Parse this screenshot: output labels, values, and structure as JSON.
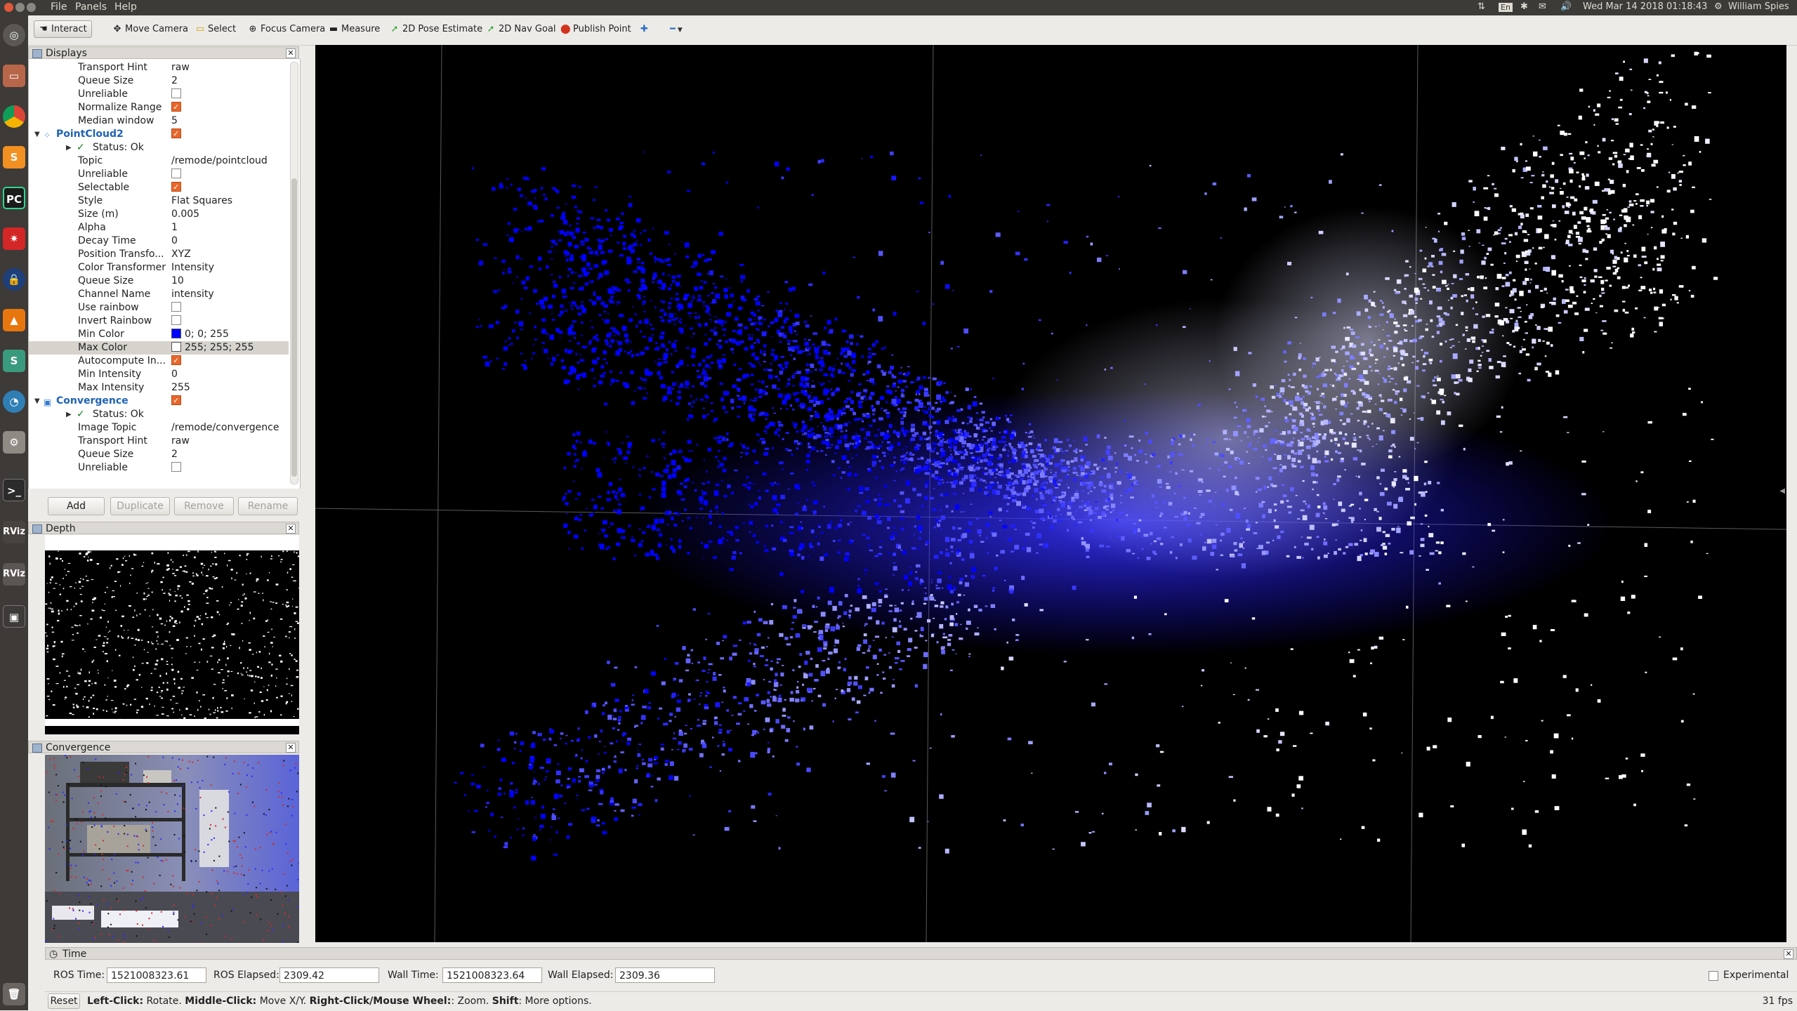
{
  "menubar": {
    "menus": [
      "File",
      "Panels",
      "Help"
    ],
    "indicators": [
      "En"
    ],
    "datetime": "Wed Mar 14 2018 01:18:43",
    "user": "William Spies"
  },
  "launcher": {
    "icons": [
      "dash-icon",
      "files-icon",
      "chrome-icon",
      "sublime-icon",
      "pycharm-icon",
      "wolfram-icon",
      "keepass-icon",
      "vlc-icon",
      "slack-icon",
      "clock-icon",
      "settings-icon",
      "terminal-icon",
      "rviz-icon",
      "rviz-icon",
      "workspace-icon",
      "trash-icon"
    ],
    "labels": {
      "slack": "S",
      "pycharm": "PC",
      "rviz": "RViz"
    }
  },
  "toolbar": {
    "interact": "Interact",
    "move_camera": "Move Camera",
    "select": "Select",
    "focus_camera": "Focus Camera",
    "measure": "Measure",
    "pose_estimate": "2D Pose Estimate",
    "nav_goal": "2D Nav Goal",
    "publish_point": "Publish Point"
  },
  "displays": {
    "title": "Displays",
    "rows": [
      {
        "key": "Transport Hint",
        "value": "raw"
      },
      {
        "key": "Queue Size",
        "value": "2"
      },
      {
        "key": "Unreliable",
        "check": false
      },
      {
        "key": "Normalize Range",
        "check": true
      },
      {
        "key": "Median window",
        "value": "5"
      },
      {
        "key": "PointCloud2",
        "plugin": true,
        "check": true
      },
      {
        "key": "Status: Ok",
        "status": true
      },
      {
        "key": "Topic",
        "value": "/remode/pointcloud"
      },
      {
        "key": "Unreliable",
        "check": false
      },
      {
        "key": "Selectable",
        "check": true
      },
      {
        "key": "Style",
        "value": "Flat Squares"
      },
      {
        "key": "Size (m)",
        "value": "0.005"
      },
      {
        "key": "Alpha",
        "value": "1"
      },
      {
        "key": "Decay Time",
        "value": "0"
      },
      {
        "key": "Position Transfo...",
        "value": "XYZ"
      },
      {
        "key": "Color Transformer",
        "value": "Intensity"
      },
      {
        "key": "Queue Size",
        "value": "10"
      },
      {
        "key": "Channel Name",
        "value": "intensity"
      },
      {
        "key": "Use rainbow",
        "check": false
      },
      {
        "key": "Invert Rainbow",
        "check": false
      },
      {
        "key": "Min Color",
        "value": "0; 0; 255",
        "swatch": "#0000ff"
      },
      {
        "key": "Max Color",
        "value": "255; 255; 255",
        "swatch": "#ffffff",
        "selected": true
      },
      {
        "key": "Autocompute In...",
        "check": true
      },
      {
        "key": "Min Intensity",
        "value": "0"
      },
      {
        "key": "Max Intensity",
        "value": "255"
      },
      {
        "key": "Convergence",
        "plugin": true,
        "check": true
      },
      {
        "key": "Status: Ok",
        "status": true
      },
      {
        "key": "Image Topic",
        "value": "/remode/convergence"
      },
      {
        "key": "Transport Hint",
        "value": "raw"
      },
      {
        "key": "Queue Size",
        "value": "2"
      },
      {
        "key": "Unreliable",
        "check": false
      }
    ],
    "buttons": {
      "add": "Add",
      "duplicate": "Duplicate",
      "remove": "Remove",
      "rename": "Rename"
    }
  },
  "depth": {
    "title": "Depth"
  },
  "convergence": {
    "title": "Convergence"
  },
  "time": {
    "title": "Time",
    "ros_time_label": "ROS Time:",
    "ros_time": "1521008323.61",
    "ros_elapsed_label": "ROS Elapsed:",
    "ros_elapsed": "2309.42",
    "wall_time_label": "Wall Time:",
    "wall_time": "1521008323.64",
    "wall_elapsed_label": "Wall Elapsed:",
    "wall_elapsed": "2309.36",
    "experimental": "Experimental"
  },
  "status": {
    "reset": "Reset",
    "hint_b1": "Left-Click:",
    "hint_t1": " Rotate. ",
    "hint_b2": "Middle-Click:",
    "hint_t2": " Move X/Y. ",
    "hint_b3": "Right-Click/Mouse Wheel:",
    "hint_t3": ": Zoom. ",
    "hint_b4": "Shift",
    "hint_t4": ": More options.",
    "fps": "31 fps"
  },
  "colors": {
    "viewport_bg": "#000000",
    "min_color": "#0000ff",
    "max_color": "#ffffff",
    "accent": "#e8672b"
  }
}
